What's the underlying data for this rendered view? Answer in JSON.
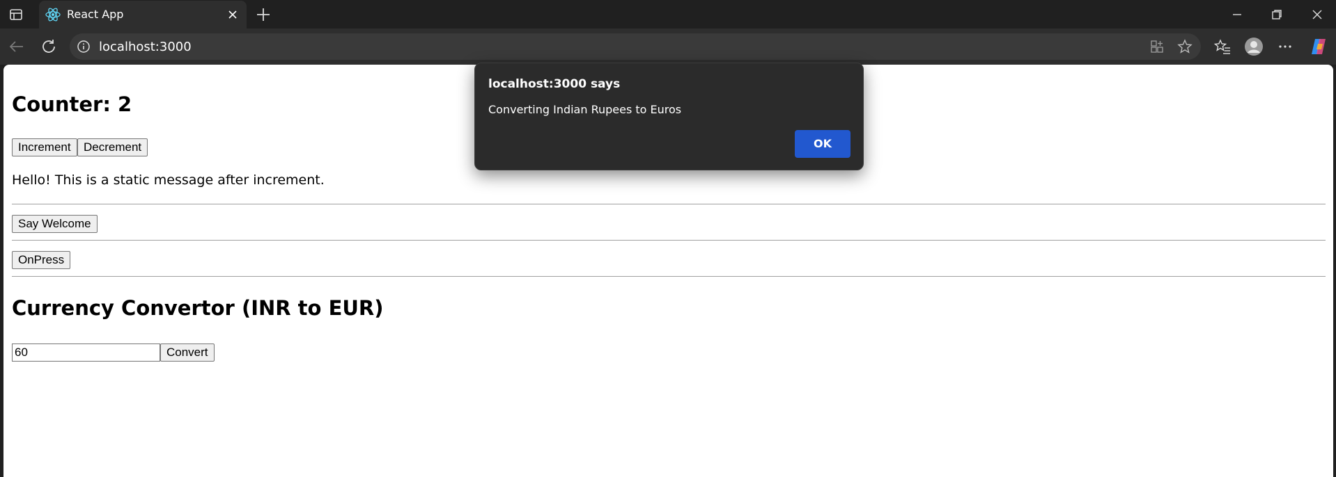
{
  "browser": {
    "tab_title": "React App",
    "url": "localhost:3000"
  },
  "page": {
    "counter_heading": "Counter: 2",
    "increment_label": "Increment",
    "decrement_label": "Decrement",
    "static_message": "Hello! This is a static message after increment.",
    "say_welcome_label": "Say Welcome",
    "onpress_label": "OnPress",
    "currency_heading": "Currency Convertor (INR to EUR)",
    "amount_value": "60",
    "convert_label": "Convert"
  },
  "dialog": {
    "title": "localhost:3000 says",
    "message": "Converting Indian Rupees to Euros",
    "ok_label": "OK",
    "ok_color": "#2258cf"
  },
  "icons": [
    "sidebar-icon",
    "react-icon",
    "close-icon",
    "plus-icon",
    "minimize-icon",
    "restore-icon",
    "back-icon",
    "refresh-icon",
    "info-icon",
    "apps-icon",
    "star-icon",
    "favorites-icon",
    "profile-icon",
    "more-icon",
    "copilot-icon"
  ]
}
